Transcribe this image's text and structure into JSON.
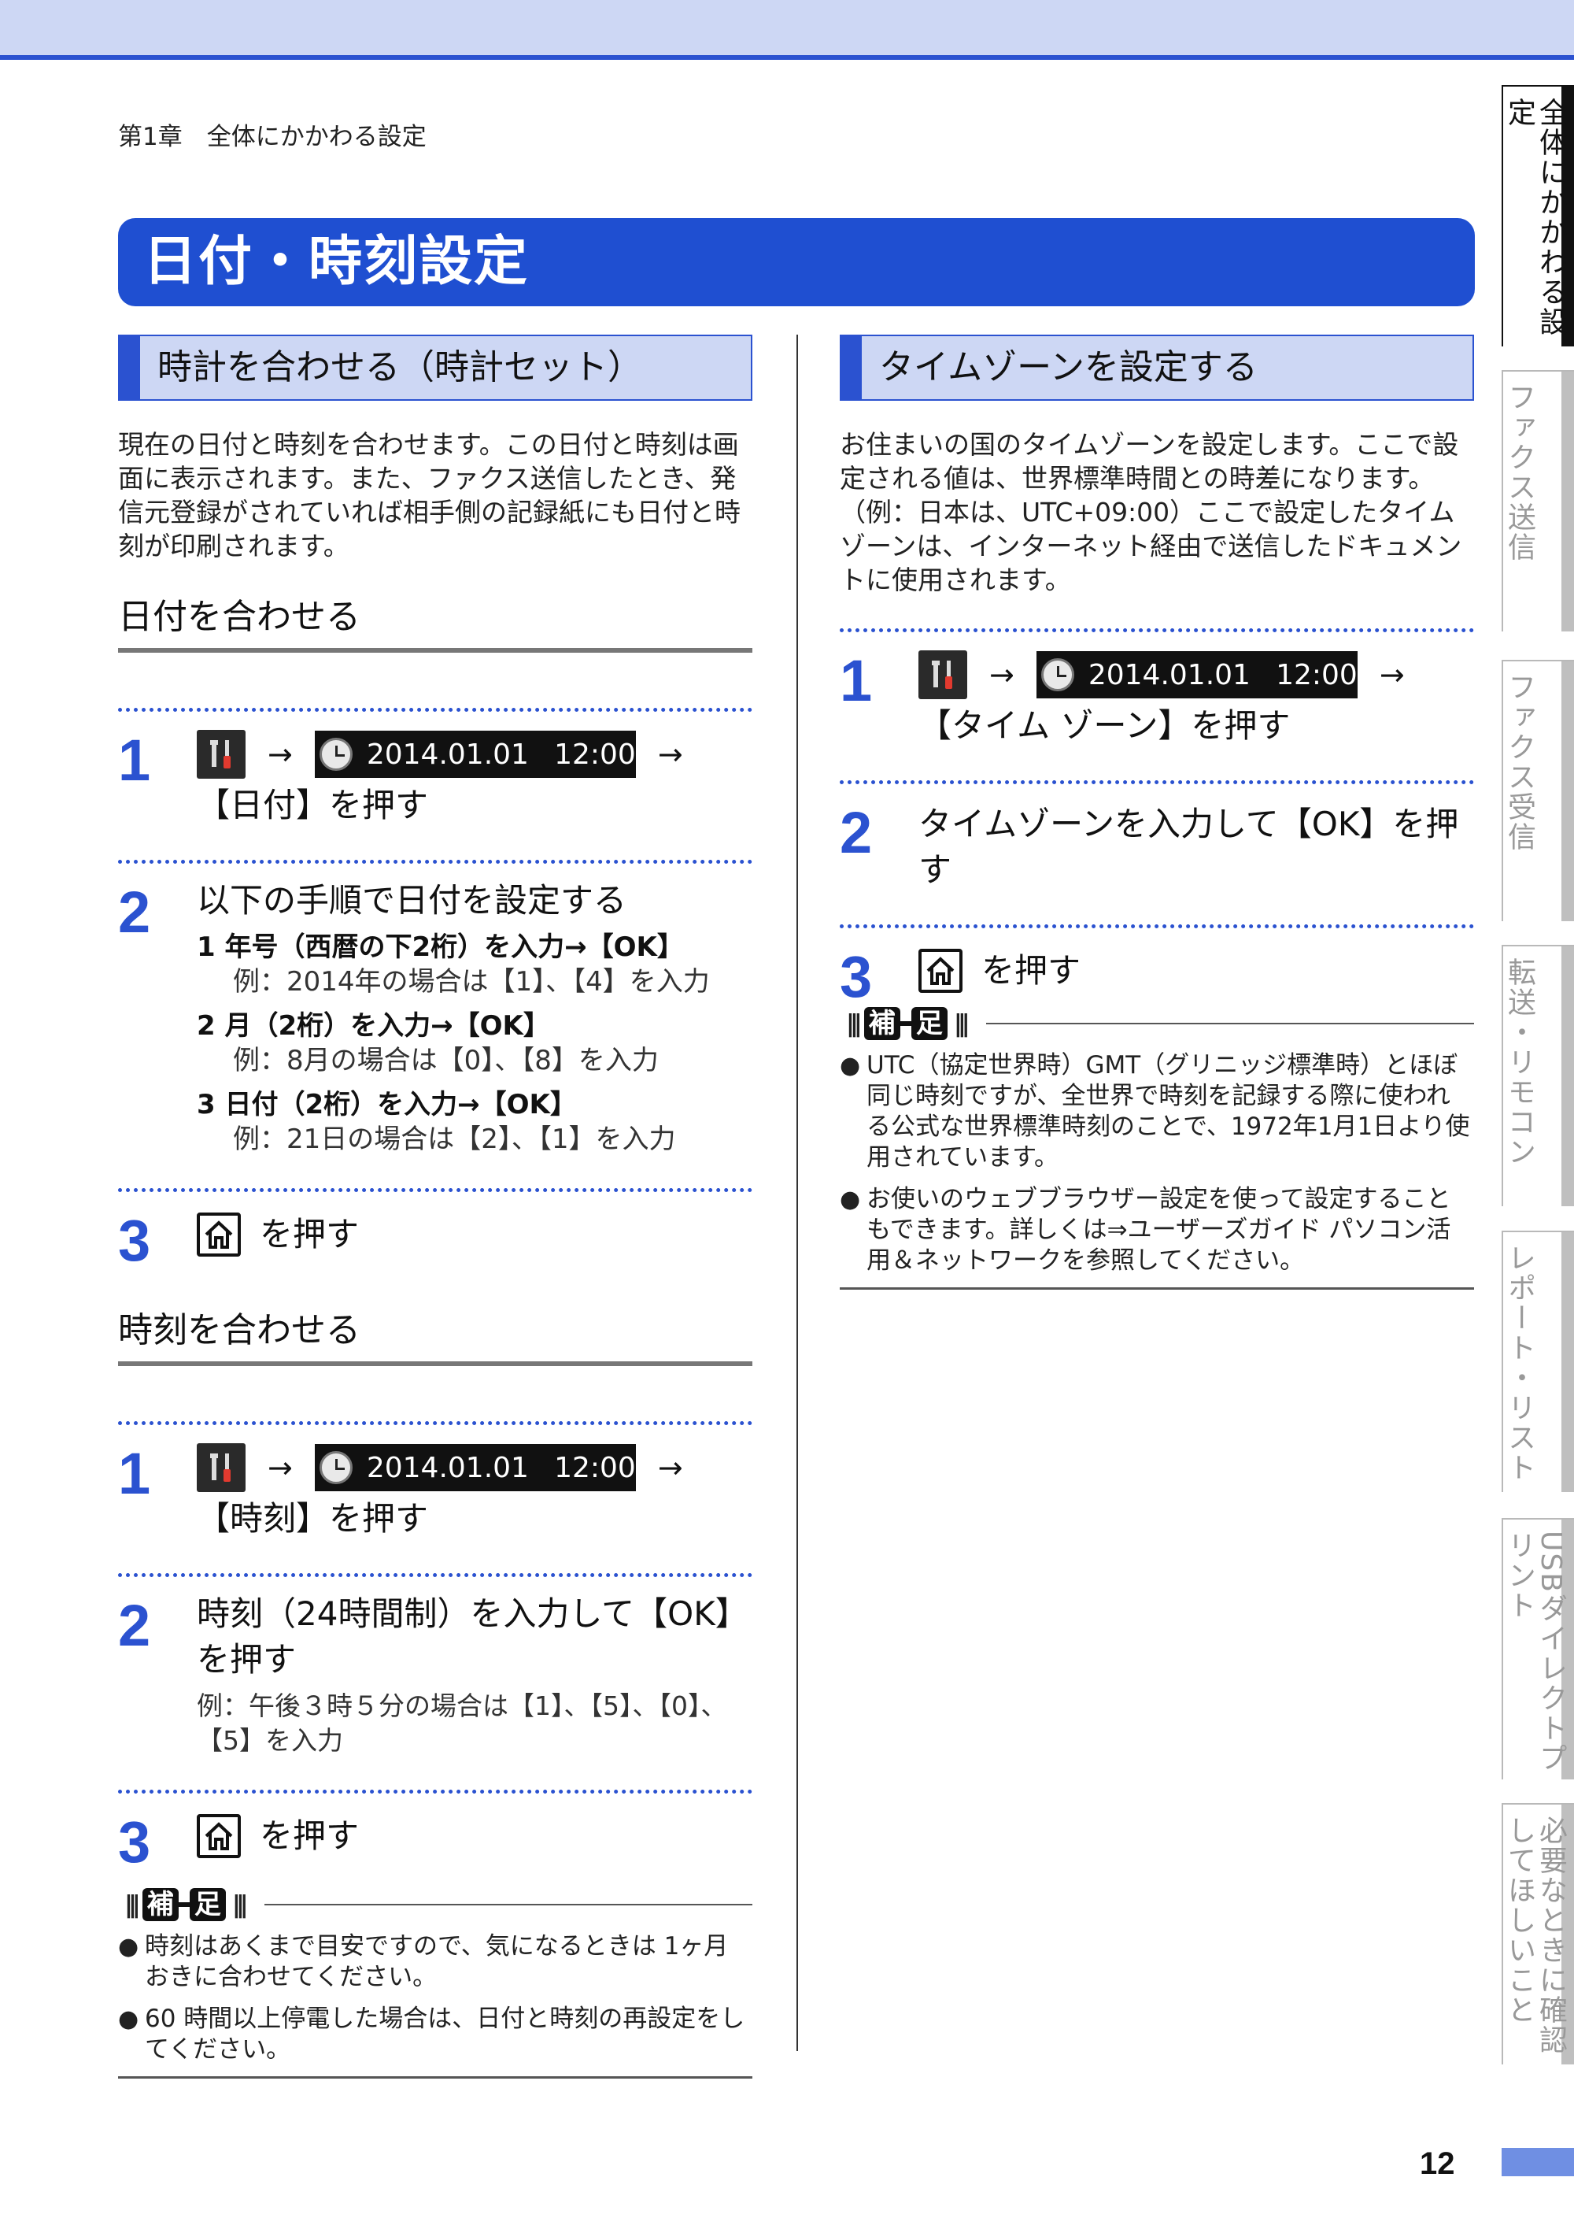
{
  "header": {
    "chapter": "第1章　全体にかかわる設定"
  },
  "banner": {
    "title": "日付・時刻設定"
  },
  "left": {
    "section_title": "時計を合わせる（時計セット）",
    "intro": "現在の日付と時刻を合わせます。この日付と時刻は画面に表示されます。また、ファクス送信したとき、発信元登録がされていれば相手側の記録紙にも日付と時刻が印刷されます。",
    "date": {
      "title": "日付を合わせる",
      "step1": {
        "num": "1",
        "arrow1": "→",
        "lcd_date": "2014.01.01",
        "lcd_time": "12:00",
        "arrow2": "→",
        "text": "【日付】を押す"
      },
      "step2": {
        "num": "2",
        "title": "以下の手順で日付を設定する",
        "items": [
          {
            "lead": "1  年号（西暦の下2桁）を入力→【OK】",
            "ex": "例：2014年の場合は【1】、【4】を入力"
          },
          {
            "lead": "2  月（2桁）を入力→【OK】",
            "ex": "例：8月の場合は【0】、【8】を入力"
          },
          {
            "lead": "3  日付（2桁）を入力→【OK】",
            "ex": "例：21日の場合は【2】、【1】を入力"
          }
        ]
      },
      "step3": {
        "num": "3",
        "text": "を押す"
      }
    },
    "time": {
      "title": "時刻を合わせる",
      "step1": {
        "num": "1",
        "arrow1": "→",
        "lcd_date": "2014.01.01",
        "lcd_time": "12:00",
        "arrow2": "→",
        "text": "【時刻】を押す"
      },
      "step2": {
        "num": "2",
        "title": "時刻（24時間制）を入力して【OK】を押す",
        "example": "例：午後３時５分の場合は【1】、【5】、【0】、【5】を入力"
      },
      "step3": {
        "num": "3",
        "text": "を押す"
      }
    },
    "note": {
      "label_a": "補",
      "label_b": "足",
      "bullets": [
        "時刻はあくまで目安ですので、気になるときは 1ヶ月おきに合わせてください。",
        "60 時間以上停電した場合は、日付と時刻の再設定をしてください。"
      ]
    }
  },
  "right": {
    "section_title": "タイムゾーンを設定する",
    "intro": "お住まいの国のタイムゾーンを設定します。ここで設定される値は、世界標準時間との時差になります。（例：日本は、UTC+09:00）ここで設定したタイムゾーンは、インターネット経由で送信したドキュメントに使用されます。",
    "step1": {
      "num": "1",
      "arrow1": "→",
      "lcd_date": "2014.01.01",
      "lcd_time": "12:00",
      "arrow2": "→",
      "text": "【タイム ゾーン】を押す"
    },
    "step2": {
      "num": "2",
      "title": "タイムゾーンを入力して【OK】を押す"
    },
    "step3": {
      "num": "3",
      "text": "を押す"
    },
    "note": {
      "label_a": "補",
      "label_b": "足",
      "bullets": [
        "UTC（協定世界時）GMT（グリニッジ標準時）とほぼ同じ時刻ですが、全世界で時刻を記録する際に使われる公式な世界標準時刻のことで、1972年1月1日より使用されています。",
        "お使いのウェブブラウザー設定を使って設定することもできます。詳しくは⇒ユーザーズガイド パソコン活用＆ネットワークを参照してください。"
      ]
    }
  },
  "side_tabs": [
    {
      "label": "全体にかかわる設定",
      "active": true
    },
    {
      "label": "ファクス送信",
      "active": false
    },
    {
      "label": "ファクス受信",
      "active": false
    },
    {
      "label": "転送・リモコン",
      "active": false
    },
    {
      "label": "レポート・リスト",
      "active": false
    },
    {
      "label": "USBダイレクトプリント",
      "active": false
    },
    {
      "label": "必要なときに確認してほしいこと",
      "active": false
    }
  ],
  "page_number": "12",
  "colors": {
    "accent": "#2b52d0",
    "band": "#cdd7f4",
    "banner": "#1f4fd1"
  }
}
